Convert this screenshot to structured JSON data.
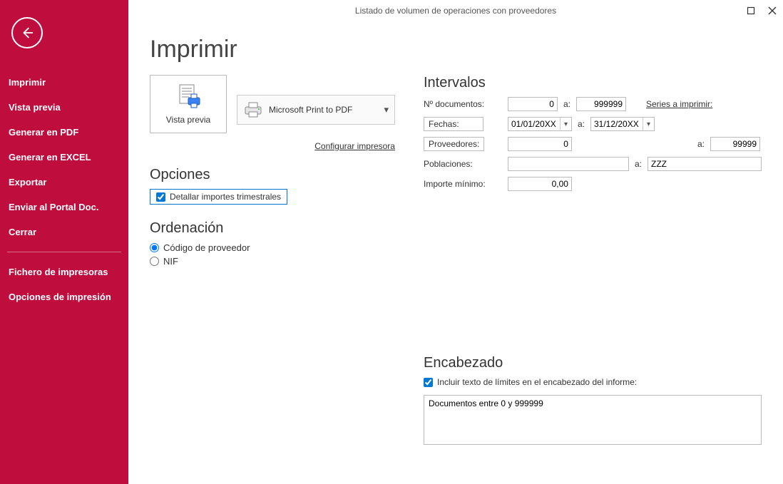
{
  "window": {
    "title": "Listado de volumen de operaciones con proveedores"
  },
  "sidebar": {
    "items": [
      {
        "label": "Imprimir"
      },
      {
        "label": "Vista previa"
      },
      {
        "label": "Generar en PDF"
      },
      {
        "label": "Generar en EXCEL"
      },
      {
        "label": "Exportar"
      },
      {
        "label": "Enviar al Portal Doc."
      },
      {
        "label": "Cerrar"
      }
    ],
    "secondary": [
      {
        "label": "Fichero de impresoras"
      },
      {
        "label": "Opciones de impresión"
      }
    ]
  },
  "page": {
    "title": "Imprimir",
    "preview_btn": "Vista previa",
    "printer_selected": "Microsoft Print to PDF",
    "configure_printer": "Configurar impresora"
  },
  "options": {
    "section_title": "Opciones",
    "detail_quarterly": "Detallar importes trimestrales",
    "detail_quarterly_checked": true
  },
  "ordering": {
    "section_title": "Ordenación",
    "by_code": "Código de proveedor",
    "by_nif": "NIF",
    "selected": "by_code"
  },
  "intervals": {
    "section_title": "Intervalos",
    "doc_label": "Nº documentos:",
    "doc_from": "0",
    "doc_to": "999999",
    "series_link": "Series a imprimir:",
    "dates_label": "Fechas:",
    "date_from": "01/01/20XX",
    "date_to": "31/12/20XX",
    "providers_label": "Proveedores:",
    "providers_from": "0",
    "providers_to": "99999",
    "towns_label": "Poblaciones:",
    "towns_from": "",
    "towns_to": "ZZZ",
    "min_amount_label": "Importe mínimo:",
    "min_amount": "0,00",
    "to_sep": "a:"
  },
  "header": {
    "section_title": "Encabezado",
    "include_limits_label": "Incluir texto de límites en el encabezado del informe:",
    "include_limits_checked": true,
    "text": "Documentos entre 0 y 999999"
  }
}
